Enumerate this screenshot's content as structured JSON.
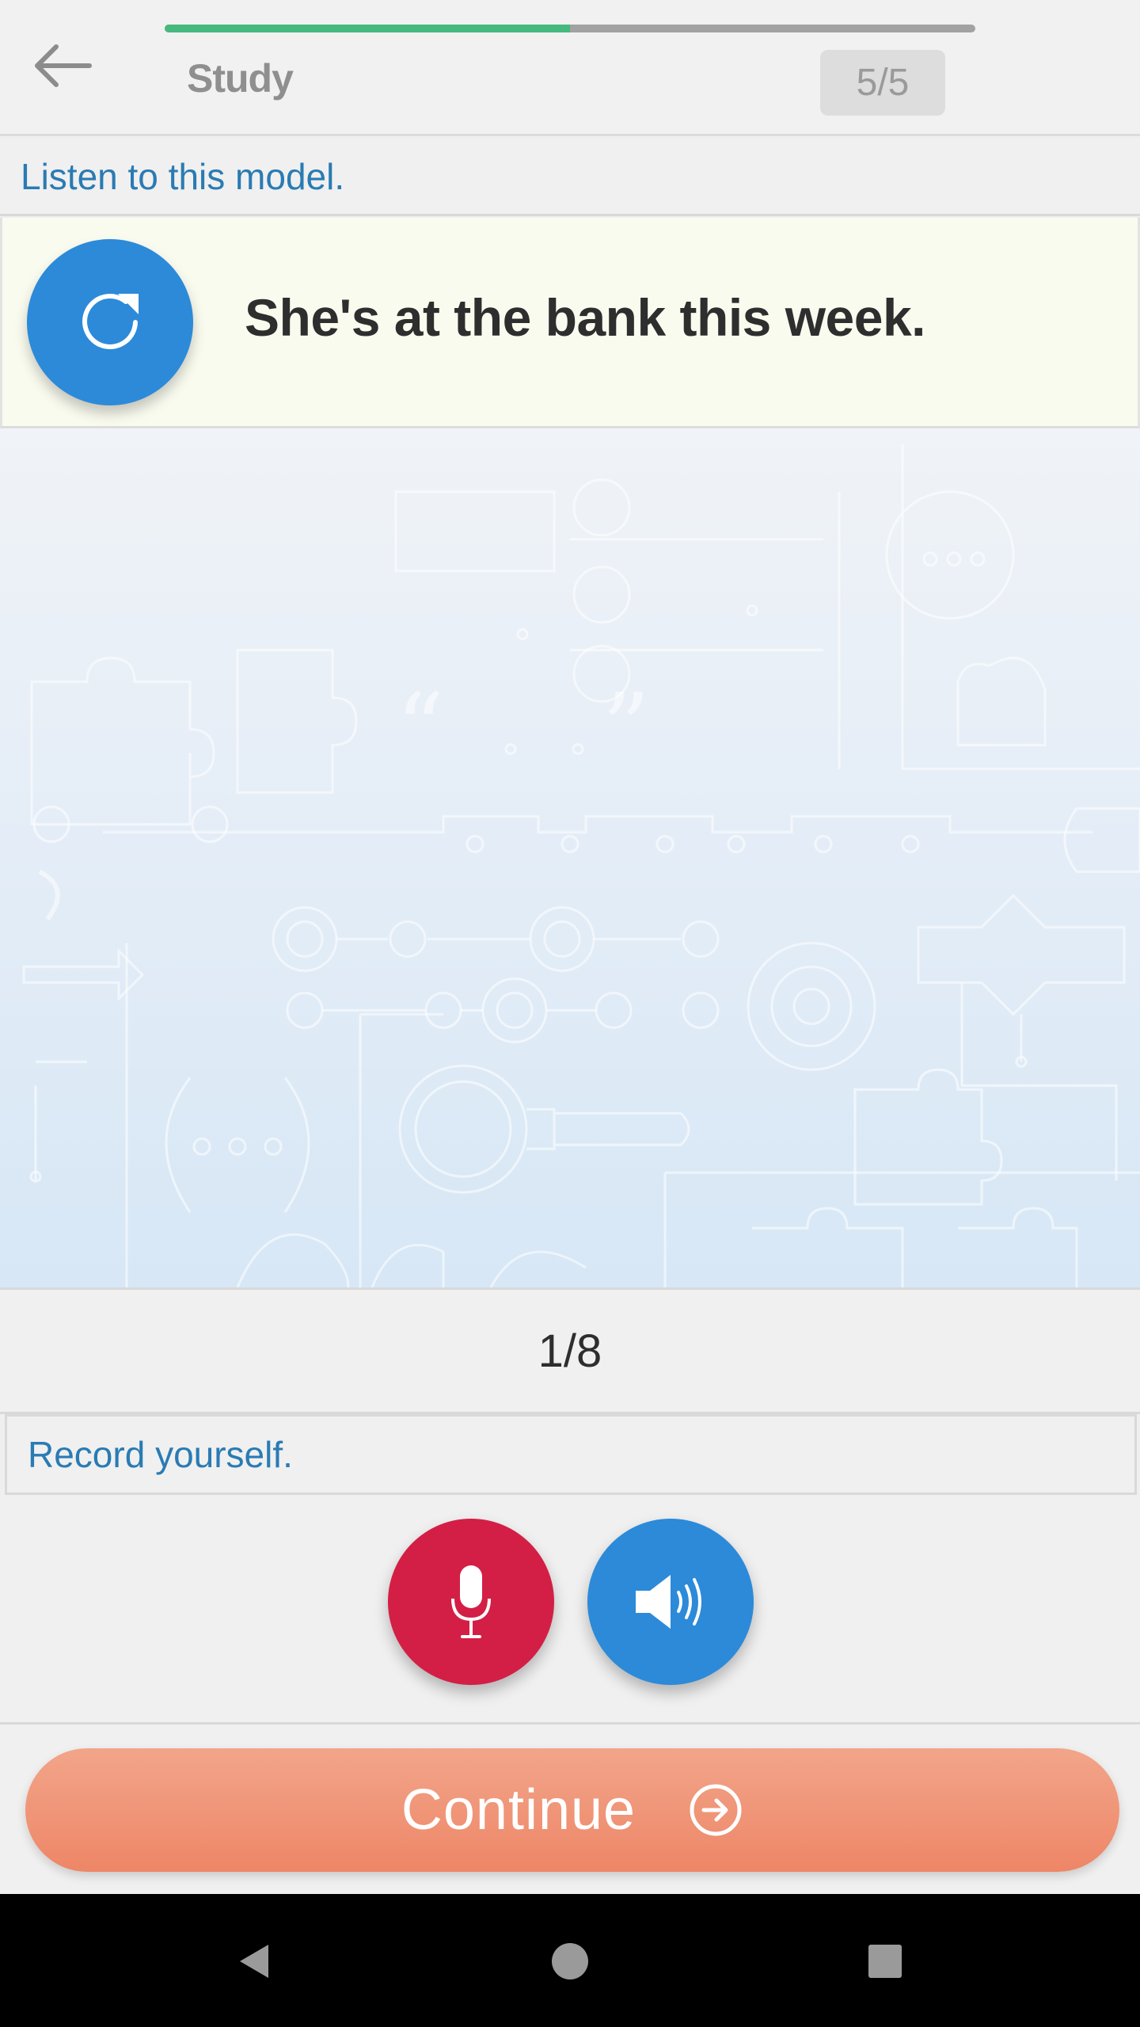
{
  "header": {
    "title": "Study",
    "counter": "5/5",
    "progress": 0.5,
    "progress_color": "#46b97e"
  },
  "listen": {
    "instruction": "Listen to this model.",
    "sentence": "She's at the bank this week."
  },
  "page_counter": "1/8",
  "record": {
    "instruction": "Record yourself."
  },
  "buttons": {
    "replay_icon": "replay-icon",
    "mic_icon": "microphone-icon",
    "speaker_icon": "speaker-icon",
    "mic_color": "#d31f45",
    "speaker_color": "#2c8ad9"
  },
  "continue": {
    "label": "Continue",
    "icon": "arrow-right-circle-icon"
  },
  "navbar": {
    "icons": [
      "nav-back-icon",
      "nav-home-icon",
      "nav-recents-icon"
    ]
  }
}
